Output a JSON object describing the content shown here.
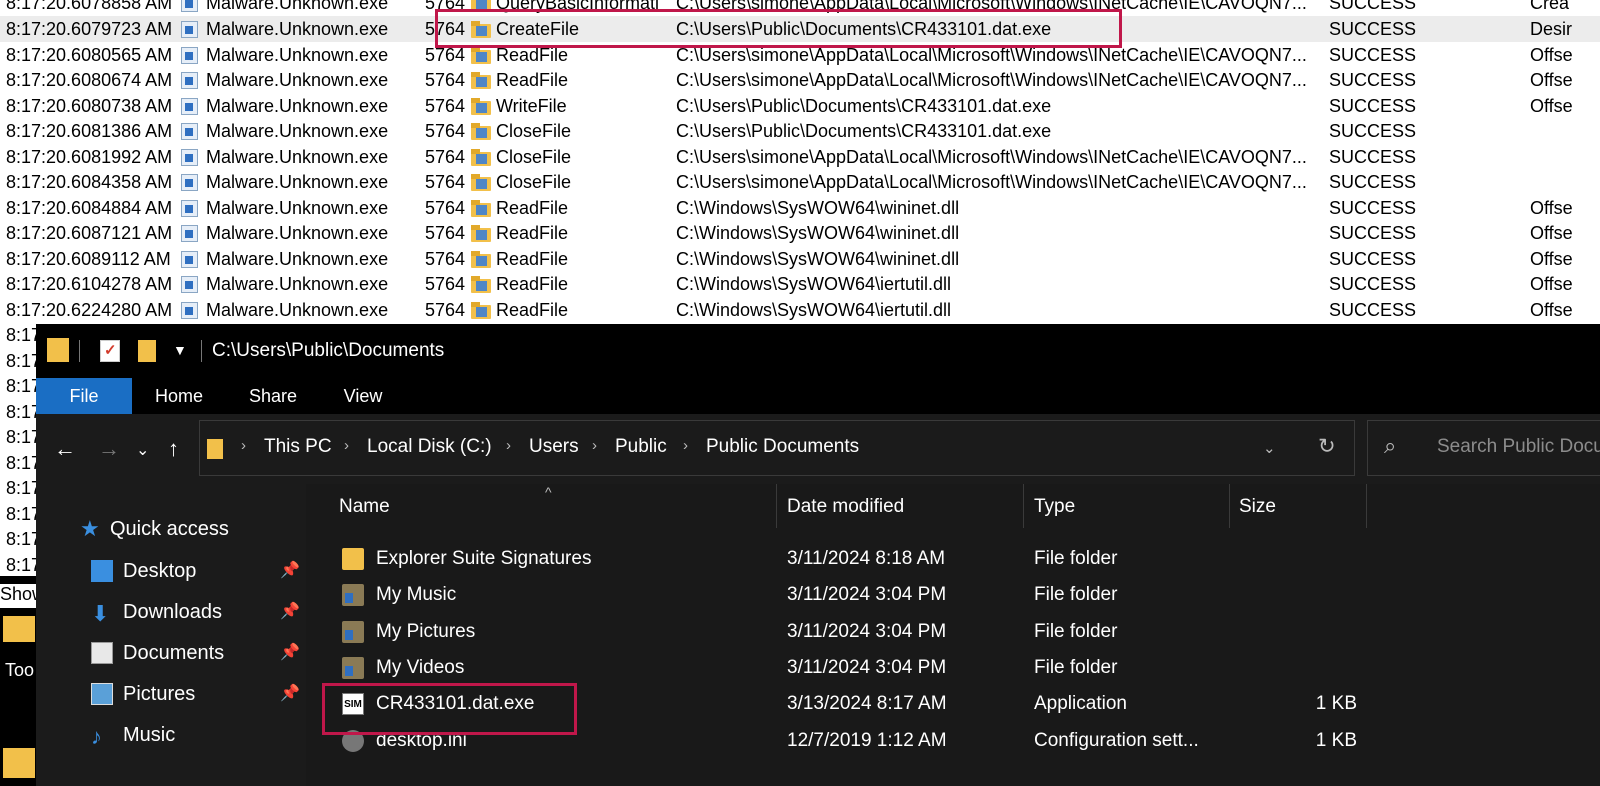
{
  "procmon": {
    "partial_top_row": {
      "time": "8:17:20.6078858 AM",
      "process": "Malware.Unknown.exe",
      "pid": "5764",
      "operation": "QueryBasicInformati",
      "path": "C:\\Users\\simone\\AppData\\Local\\Microsoft\\Windows\\INetCache\\IE\\CAVOQN7...",
      "result": "SUCCESS",
      "detail": "Crea"
    },
    "rows": [
      {
        "time": "8:17:20.6079723 AM",
        "process": "Malware.Unknown.exe",
        "pid": "5764",
        "operation": "CreateFile",
        "path": "C:\\Users\\Public\\Documents\\CR433101.dat.exe",
        "result": "SUCCESS",
        "detail": "Desir"
      },
      {
        "time": "8:17:20.6080565 AM",
        "process": "Malware.Unknown.exe",
        "pid": "5764",
        "operation": "ReadFile",
        "path": "C:\\Users\\simone\\AppData\\Local\\Microsoft\\Windows\\INetCache\\IE\\CAVOQN7...",
        "result": "SUCCESS",
        "detail": "Offse"
      },
      {
        "time": "8:17:20.6080674 AM",
        "process": "Malware.Unknown.exe",
        "pid": "5764",
        "operation": "ReadFile",
        "path": "C:\\Users\\simone\\AppData\\Local\\Microsoft\\Windows\\INetCache\\IE\\CAVOQN7...",
        "result": "SUCCESS",
        "detail": "Offse"
      },
      {
        "time": "8:17:20.6080738 AM",
        "process": "Malware.Unknown.exe",
        "pid": "5764",
        "operation": "WriteFile",
        "path": "C:\\Users\\Public\\Documents\\CR433101.dat.exe",
        "result": "SUCCESS",
        "detail": "Offse"
      },
      {
        "time": "8:17:20.6081386 AM",
        "process": "Malware.Unknown.exe",
        "pid": "5764",
        "operation": "CloseFile",
        "path": "C:\\Users\\Public\\Documents\\CR433101.dat.exe",
        "result": "SUCCESS",
        "detail": ""
      },
      {
        "time": "8:17:20.6081992 AM",
        "process": "Malware.Unknown.exe",
        "pid": "5764",
        "operation": "CloseFile",
        "path": "C:\\Users\\simone\\AppData\\Local\\Microsoft\\Windows\\INetCache\\IE\\CAVOQN7...",
        "result": "SUCCESS",
        "detail": ""
      },
      {
        "time": "8:17:20.6084358 AM",
        "process": "Malware.Unknown.exe",
        "pid": "5764",
        "operation": "CloseFile",
        "path": "C:\\Users\\simone\\AppData\\Local\\Microsoft\\Windows\\INetCache\\IE\\CAVOQN7...",
        "result": "SUCCESS",
        "detail": ""
      },
      {
        "time": "8:17:20.6084884 AM",
        "process": "Malware.Unknown.exe",
        "pid": "5764",
        "operation": "ReadFile",
        "path": "C:\\Windows\\SysWOW64\\wininet.dll",
        "result": "SUCCESS",
        "detail": "Offse"
      },
      {
        "time": "8:17:20.6087121 AM",
        "process": "Malware.Unknown.exe",
        "pid": "5764",
        "operation": "ReadFile",
        "path": "C:\\Windows\\SysWOW64\\wininet.dll",
        "result": "SUCCESS",
        "detail": "Offse"
      },
      {
        "time": "8:17:20.6089112 AM",
        "process": "Malware.Unknown.exe",
        "pid": "5764",
        "operation": "ReadFile",
        "path": "C:\\Windows\\SysWOW64\\wininet.dll",
        "result": "SUCCESS",
        "detail": "Offse"
      },
      {
        "time": "8:17:20.6104278 AM",
        "process": "Malware.Unknown.exe",
        "pid": "5764",
        "operation": "ReadFile",
        "path": "C:\\Windows\\SysWOW64\\iertutil.dll",
        "result": "SUCCESS",
        "detail": "Offse"
      },
      {
        "time": "8:17:20.6224280 AM",
        "process": "Malware.Unknown.exe",
        "pid": "5764",
        "operation": "ReadFile",
        "path": "C:\\Windows\\SysWOW64\\iertutil.dll",
        "result": "SUCCESS",
        "detail": "Offse"
      }
    ],
    "clipped_time_stub": "8:17",
    "status_stub": "Show",
    "desktop_label_stub": "Too"
  },
  "explorer": {
    "title_path": "C:\\Users\\Public\\Documents",
    "ribbon_tabs": {
      "file": "File",
      "home": "Home",
      "share": "Share",
      "view": "View"
    },
    "breadcrumbs": [
      "This PC",
      "Local Disk (C:)",
      "Users",
      "Public",
      "Public Documents"
    ],
    "search_placeholder": "Search Public Documents",
    "nav_pane": {
      "quick_access": "Quick access",
      "items": [
        {
          "label": "Desktop",
          "icon": "desktop-icon",
          "pinned": true
        },
        {
          "label": "Downloads",
          "icon": "downloads-icon",
          "pinned": true
        },
        {
          "label": "Documents",
          "icon": "documents-icon",
          "pinned": true
        },
        {
          "label": "Pictures",
          "icon": "pictures-icon",
          "pinned": true
        },
        {
          "label": "Music",
          "icon": "music-icon",
          "pinned": false
        }
      ]
    },
    "columns": {
      "name": "Name",
      "date": "Date modified",
      "type": "Type",
      "size": "Size"
    },
    "files": [
      {
        "name": "Explorer Suite Signatures",
        "date": "3/11/2024 8:18 AM",
        "type": "File folder",
        "size": "",
        "icon": "folder-icon"
      },
      {
        "name": "My Music",
        "date": "3/11/2024 3:04 PM",
        "type": "File folder",
        "size": "",
        "icon": "shortcut-folder-icon"
      },
      {
        "name": "My Pictures",
        "date": "3/11/2024 3:04 PM",
        "type": "File folder",
        "size": "",
        "icon": "shortcut-folder-icon"
      },
      {
        "name": "My Videos",
        "date": "3/11/2024 3:04 PM",
        "type": "File folder",
        "size": "",
        "icon": "shortcut-folder-icon"
      },
      {
        "name": "CR433101.dat.exe",
        "date": "3/13/2024 8:17 AM",
        "type": "Application",
        "size": "1 KB",
        "icon": "application-icon",
        "icon_text": "SIM"
      },
      {
        "name": "desktop.ini",
        "date": "12/7/2019 1:12 AM",
        "type": "Configuration sett...",
        "size": "1 KB",
        "icon": "settings-file-icon"
      }
    ]
  },
  "colors": {
    "highlight_box": "#c0174a",
    "file_tab": "#1a6ec4",
    "folder": "#f2c04a"
  }
}
